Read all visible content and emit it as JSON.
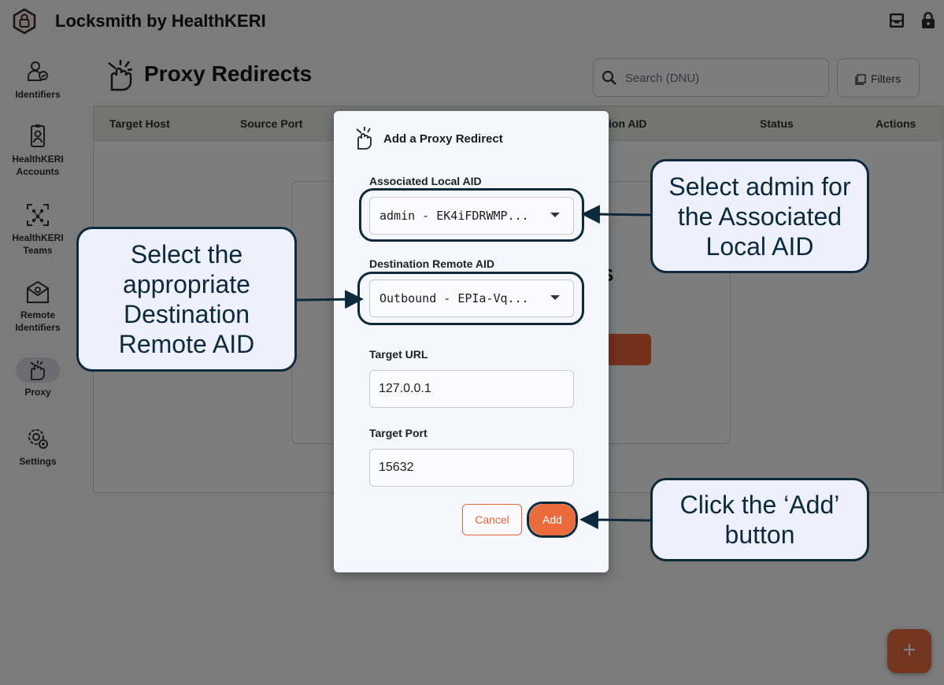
{
  "app": {
    "title": "Locksmith by HealthKERI",
    "top_icons": [
      "inbox-icon",
      "lock-icon"
    ]
  },
  "sidebar": {
    "items": [
      {
        "label": "Identifiers",
        "icon": "identifiers-icon"
      },
      {
        "label": "HealthKERI Accounts",
        "icon": "accounts-icon"
      },
      {
        "label": "HealthKERI Teams",
        "icon": "teams-icon"
      },
      {
        "label": "Remote Identifiers",
        "icon": "remote-identifiers-icon"
      },
      {
        "label": "Proxy",
        "icon": "proxy-icon",
        "active": true
      },
      {
        "label": "Settings",
        "icon": "settings-icon"
      }
    ]
  },
  "page": {
    "title": "Proxy Redirects",
    "search_placeholder": "Search (DNU)",
    "filters_label": "Filters",
    "columns": [
      "Target Host",
      "Source Port",
      "ion AID",
      "Status",
      "Actions"
    ],
    "empty_title_fragment": "TS"
  },
  "dialog": {
    "title": "Add a Proxy Redirect",
    "local_aid_label": "Associated Local AID",
    "local_aid_value": "admin - EK4iFDRWMP...",
    "remote_aid_label": "Destination Remote AID",
    "remote_aid_value": "Outbound - EPIa-Vq...",
    "target_url_label": "Target URL",
    "target_url_value": "127.0.0.1",
    "target_port_label": "Target Port",
    "target_port_value": "15632",
    "cancel_label": "Cancel",
    "add_label": "Add"
  },
  "callouts": {
    "local_aid": "Select admin for the Associated Local AID",
    "remote_aid": "Select the appropriate Destination Remote AID",
    "add": "Click the ‘Add’ button"
  },
  "fab": {
    "label": "+"
  },
  "colors": {
    "accent": "#ec6b3c",
    "callout_border": "#0d2a3c",
    "callout_fill": "#eef1fb"
  }
}
